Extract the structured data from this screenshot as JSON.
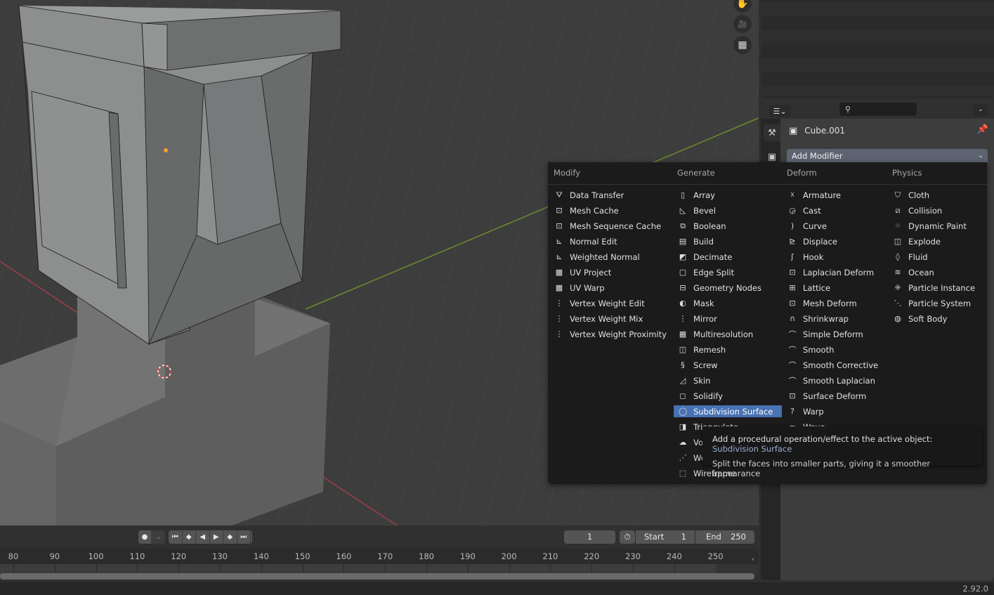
{
  "viewport": {
    "nav_buttons": [
      {
        "icon": "hand-pan-icon",
        "glyph": "✋"
      },
      {
        "icon": "camera-icon",
        "glyph": "🎥"
      },
      {
        "icon": "grid-ortho-icon",
        "glyph": "▦"
      }
    ]
  },
  "properties": {
    "editor_type_icon": "properties-editor-icon",
    "search_placeholder": "",
    "object_name": "Cube.001",
    "add_modifier_label": "Add Modifier",
    "tabs": [
      "tool-tab",
      "render-tab",
      "output-tab",
      "view-layer-tab",
      "scene-tab",
      "world-tab",
      "object-tab",
      "modifier-tab",
      "particles-tab",
      "physics-tab",
      "constraints-tab",
      "data-tab",
      "material-tab"
    ]
  },
  "menu": {
    "columns": [
      {
        "heading": "Modify",
        "items": [
          {
            "label": "Data Transfer",
            "icon": "data-transfer-icon",
            "glyph": "⛛"
          },
          {
            "label": "Mesh Cache",
            "icon": "mesh-cache-icon",
            "glyph": "⊡"
          },
          {
            "label": "Mesh Sequence Cache",
            "icon": "mesh-sequence-cache-icon",
            "glyph": "⊡"
          },
          {
            "label": "Normal Edit",
            "icon": "normal-edit-icon",
            "glyph": "⊾"
          },
          {
            "label": "Weighted Normal",
            "icon": "weighted-normal-icon",
            "glyph": "⊾"
          },
          {
            "label": "UV Project",
            "icon": "uv-project-icon",
            "glyph": "▩"
          },
          {
            "label": "UV Warp",
            "icon": "uv-warp-icon",
            "glyph": "▩"
          },
          {
            "label": "Vertex Weight Edit",
            "icon": "vertex-weight-edit-icon",
            "glyph": "⋮"
          },
          {
            "label": "Vertex Weight Mix",
            "icon": "vertex-weight-mix-icon",
            "glyph": "⋮"
          },
          {
            "label": "Vertex Weight Proximity",
            "icon": "vertex-weight-proximity-icon",
            "glyph": "⋮"
          }
        ]
      },
      {
        "heading": "Generate",
        "items": [
          {
            "label": "Array",
            "icon": "array-icon",
            "glyph": "▯"
          },
          {
            "label": "Bevel",
            "icon": "bevel-icon",
            "glyph": "◺"
          },
          {
            "label": "Boolean",
            "icon": "boolean-icon",
            "glyph": "⧉"
          },
          {
            "label": "Build",
            "icon": "build-icon",
            "glyph": "▤"
          },
          {
            "label": "Decimate",
            "icon": "decimate-icon",
            "glyph": "◩"
          },
          {
            "label": "Edge Split",
            "icon": "edge-split-icon",
            "glyph": "▢"
          },
          {
            "label": "Geometry Nodes",
            "icon": "geometry-nodes-icon",
            "glyph": "⊟"
          },
          {
            "label": "Mask",
            "icon": "mask-icon",
            "glyph": "◐"
          },
          {
            "label": "Mirror",
            "icon": "mirror-icon",
            "glyph": "⋮"
          },
          {
            "label": "Multiresolution",
            "icon": "multiresolution-icon",
            "glyph": "▦"
          },
          {
            "label": "Remesh",
            "icon": "remesh-icon",
            "glyph": "◫"
          },
          {
            "label": "Screw",
            "icon": "screw-icon",
            "glyph": "§"
          },
          {
            "label": "Skin",
            "icon": "skin-icon",
            "glyph": "◿"
          },
          {
            "label": "Solidify",
            "icon": "solidify-icon",
            "glyph": "◻"
          },
          {
            "label": "Subdivision Surface",
            "icon": "subdivision-surface-icon",
            "glyph": "◯"
          },
          {
            "label": "Triangulate",
            "icon": "triangulate-icon",
            "glyph": "◨"
          },
          {
            "label": "Volume to Mesh",
            "icon": "volume-to-mesh-icon",
            "glyph": "☁"
          },
          {
            "label": "Weld",
            "icon": "weld-icon",
            "glyph": "⋰"
          },
          {
            "label": "Wireframe",
            "icon": "wireframe-icon",
            "glyph": "⬚"
          }
        ]
      },
      {
        "heading": "Deform",
        "items": [
          {
            "label": "Armature",
            "icon": "armature-icon",
            "glyph": "☓"
          },
          {
            "label": "Cast",
            "icon": "cast-icon",
            "glyph": "◶"
          },
          {
            "label": "Curve",
            "icon": "curve-icon",
            "glyph": ")"
          },
          {
            "label": "Displace",
            "icon": "displace-icon",
            "glyph": "⊵"
          },
          {
            "label": "Hook",
            "icon": "hook-icon",
            "glyph": "ʃ"
          },
          {
            "label": "Laplacian Deform",
            "icon": "laplacian-deform-icon",
            "glyph": "⊡"
          },
          {
            "label": "Lattice",
            "icon": "lattice-icon",
            "glyph": "⊞"
          },
          {
            "label": "Mesh Deform",
            "icon": "mesh-deform-icon",
            "glyph": "⊡"
          },
          {
            "label": "Shrinkwrap",
            "icon": "shrinkwrap-icon",
            "glyph": "∩"
          },
          {
            "label": "Simple Deform",
            "icon": "simple-deform-icon",
            "glyph": "⌒"
          },
          {
            "label": "Smooth",
            "icon": "smooth-icon",
            "glyph": "⌒"
          },
          {
            "label": "Smooth Corrective",
            "icon": "smooth-corrective-icon",
            "glyph": "⌒"
          },
          {
            "label": "Smooth Laplacian",
            "icon": "smooth-laplacian-icon",
            "glyph": "⌒"
          },
          {
            "label": "Surface Deform",
            "icon": "surface-deform-icon",
            "glyph": "⊡"
          },
          {
            "label": "Warp",
            "icon": "warp-icon",
            "glyph": "?"
          },
          {
            "label": "Wave",
            "icon": "wave-icon",
            "glyph": "≈"
          }
        ]
      },
      {
        "heading": "Physics",
        "items": [
          {
            "label": "Cloth",
            "icon": "cloth-icon",
            "glyph": "⛉"
          },
          {
            "label": "Collision",
            "icon": "collision-icon",
            "glyph": "⧄"
          },
          {
            "label": "Dynamic Paint",
            "icon": "dynamic-paint-icon",
            "glyph": "⁘"
          },
          {
            "label": "Explode",
            "icon": "explode-icon",
            "glyph": "◫"
          },
          {
            "label": "Fluid",
            "icon": "fluid-icon",
            "glyph": "◊"
          },
          {
            "label": "Ocean",
            "icon": "ocean-icon",
            "glyph": "≋"
          },
          {
            "label": "Particle Instance",
            "icon": "particle-instance-icon",
            "glyph": "⁜"
          },
          {
            "label": "Particle System",
            "icon": "particle-system-icon",
            "glyph": "⋱"
          },
          {
            "label": "Soft Body",
            "icon": "soft-body-icon",
            "glyph": "◍"
          }
        ]
      }
    ],
    "highlighted": "Subdivision Surface"
  },
  "tooltip": {
    "line1_prefix": "Add a procedural operation/effect to the active object:",
    "line1_value": "Subdivision Surface",
    "line2": "Split the faces into smaller parts, giving it a smoother appearance"
  },
  "timeline": {
    "record_icon": "record-icon",
    "playback_buttons": [
      {
        "icon": "jump-start-icon",
        "glyph": "⏮"
      },
      {
        "icon": "prev-keyframe-icon",
        "glyph": "◆"
      },
      {
        "icon": "play-reverse-icon",
        "glyph": "◀"
      },
      {
        "icon": "play-icon",
        "glyph": "▶"
      },
      {
        "icon": "next-keyframe-icon",
        "glyph": "◆"
      },
      {
        "icon": "jump-end-icon",
        "glyph": "⏭"
      }
    ],
    "current_frame": "1",
    "start_label": "Start",
    "start_value": "1",
    "end_label": "End",
    "end_value": "250",
    "ruler_ticks": [
      "80",
      "90",
      "100",
      "110",
      "120",
      "130",
      "140",
      "150",
      "160",
      "170",
      "180",
      "190",
      "200",
      "210",
      "220",
      "230",
      "240",
      "250"
    ]
  },
  "statusbar": {
    "version": "2.92.0"
  }
}
